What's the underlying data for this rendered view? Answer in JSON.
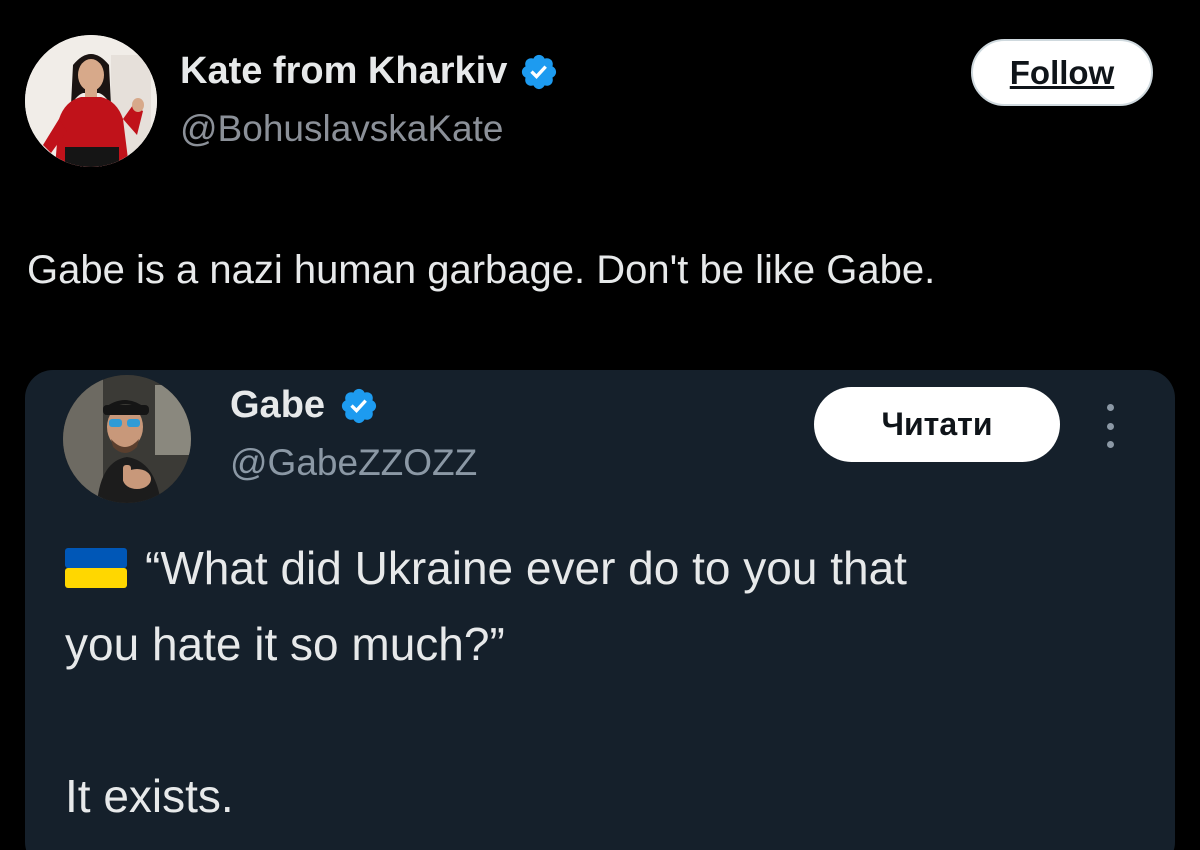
{
  "author": {
    "name": "Kate from Kharkiv",
    "handle": "@BohuslavskaKate",
    "verified": true,
    "avatar_icon": "profile-photo-woman-red-shirt"
  },
  "follow_label": "Follow",
  "tweet_text": "Gabe is a nazi human garbage.  Don't be like Gabe.",
  "quoted_tweet": {
    "name": "Gabe",
    "handle": "@GabeZZOZZ",
    "verified": true,
    "avatar_icon": "profile-photo-man-sunglasses",
    "read_label": "Читати",
    "more_icon": "vertical-ellipsis-icon",
    "flag_icon": "ukraine-flag-emoji",
    "line1": "“What did Ukraine ever do to you that",
    "line2": "you hate it so much?”",
    "line3": "It exists."
  },
  "colors": {
    "background": "#000000",
    "card_background": "#15202b",
    "verified_blue": "#1d9bf0",
    "text_primary": "#e7e9ea",
    "text_secondary": "#8b9098",
    "flag_blue": "#0057b7",
    "flag_yellow": "#ffd700"
  }
}
